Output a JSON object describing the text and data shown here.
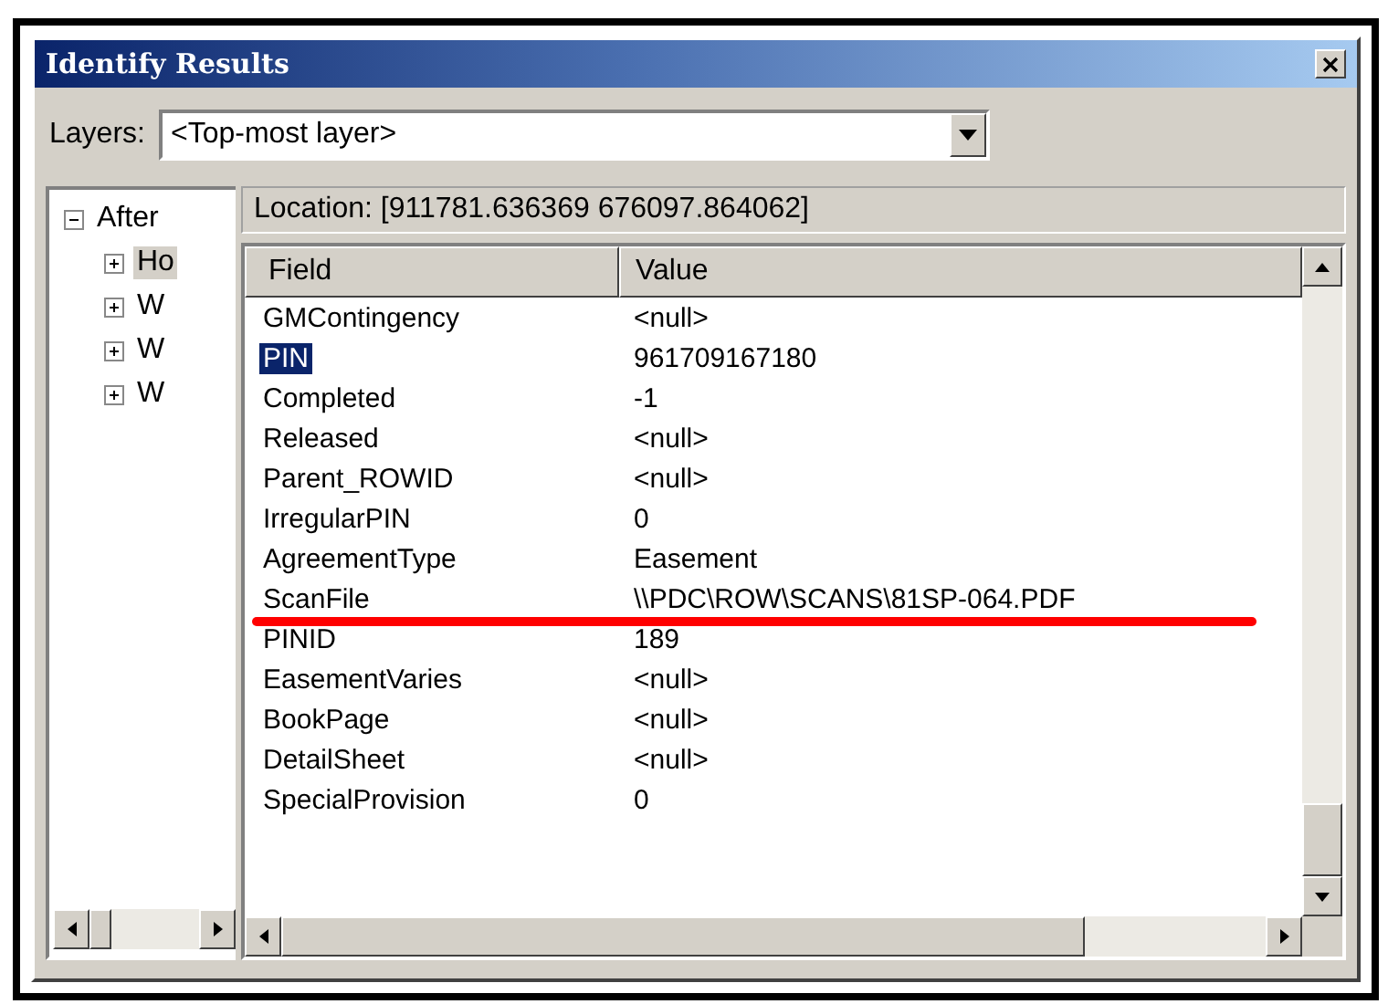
{
  "window": {
    "title": "Identify Results"
  },
  "layers": {
    "label": "Layers:",
    "value": "<Top-most layer>"
  },
  "tree": [
    {
      "label": "After",
      "expanded": true,
      "selected": false,
      "children": [
        {
          "label": "Ho",
          "expanded": false,
          "selected": true
        },
        {
          "label": "W",
          "expanded": false,
          "selected": false
        },
        {
          "label": "W",
          "expanded": false,
          "selected": false
        },
        {
          "label": "W",
          "expanded": false,
          "selected": false
        }
      ]
    }
  ],
  "location": "Location: [911781.636369 676097.864062]",
  "table": {
    "columns": [
      "Field",
      "Value"
    ],
    "rows": [
      {
        "field": "GMContingency",
        "value": "<null>",
        "selected": false,
        "underlined": false
      },
      {
        "field": "PIN",
        "value": "961709167180",
        "selected": true,
        "underlined": false
      },
      {
        "field": "Completed",
        "value": "-1",
        "selected": false,
        "underlined": false
      },
      {
        "field": "Released",
        "value": "<null>",
        "selected": false,
        "underlined": false
      },
      {
        "field": "Parent_ROWID",
        "value": "<null>",
        "selected": false,
        "underlined": false
      },
      {
        "field": "IrregularPIN",
        "value": "0",
        "selected": false,
        "underlined": false
      },
      {
        "field": "AgreementType",
        "value": "Easement",
        "selected": false,
        "underlined": false
      },
      {
        "field": "ScanFile",
        "value": "\\\\PDC\\ROW\\SCANS\\81SP-064.PDF",
        "selected": false,
        "underlined": true
      },
      {
        "field": "PINID",
        "value": "189",
        "selected": false,
        "underlined": false
      },
      {
        "field": "EasementVaries",
        "value": "<null>",
        "selected": false,
        "underlined": false
      },
      {
        "field": "BookPage",
        "value": "<null>",
        "selected": false,
        "underlined": false
      },
      {
        "field": "DetailSheet",
        "value": "<null>",
        "selected": false,
        "underlined": false
      },
      {
        "field": "SpecialProvision",
        "value": "0",
        "selected": false,
        "underlined": false
      }
    ]
  }
}
